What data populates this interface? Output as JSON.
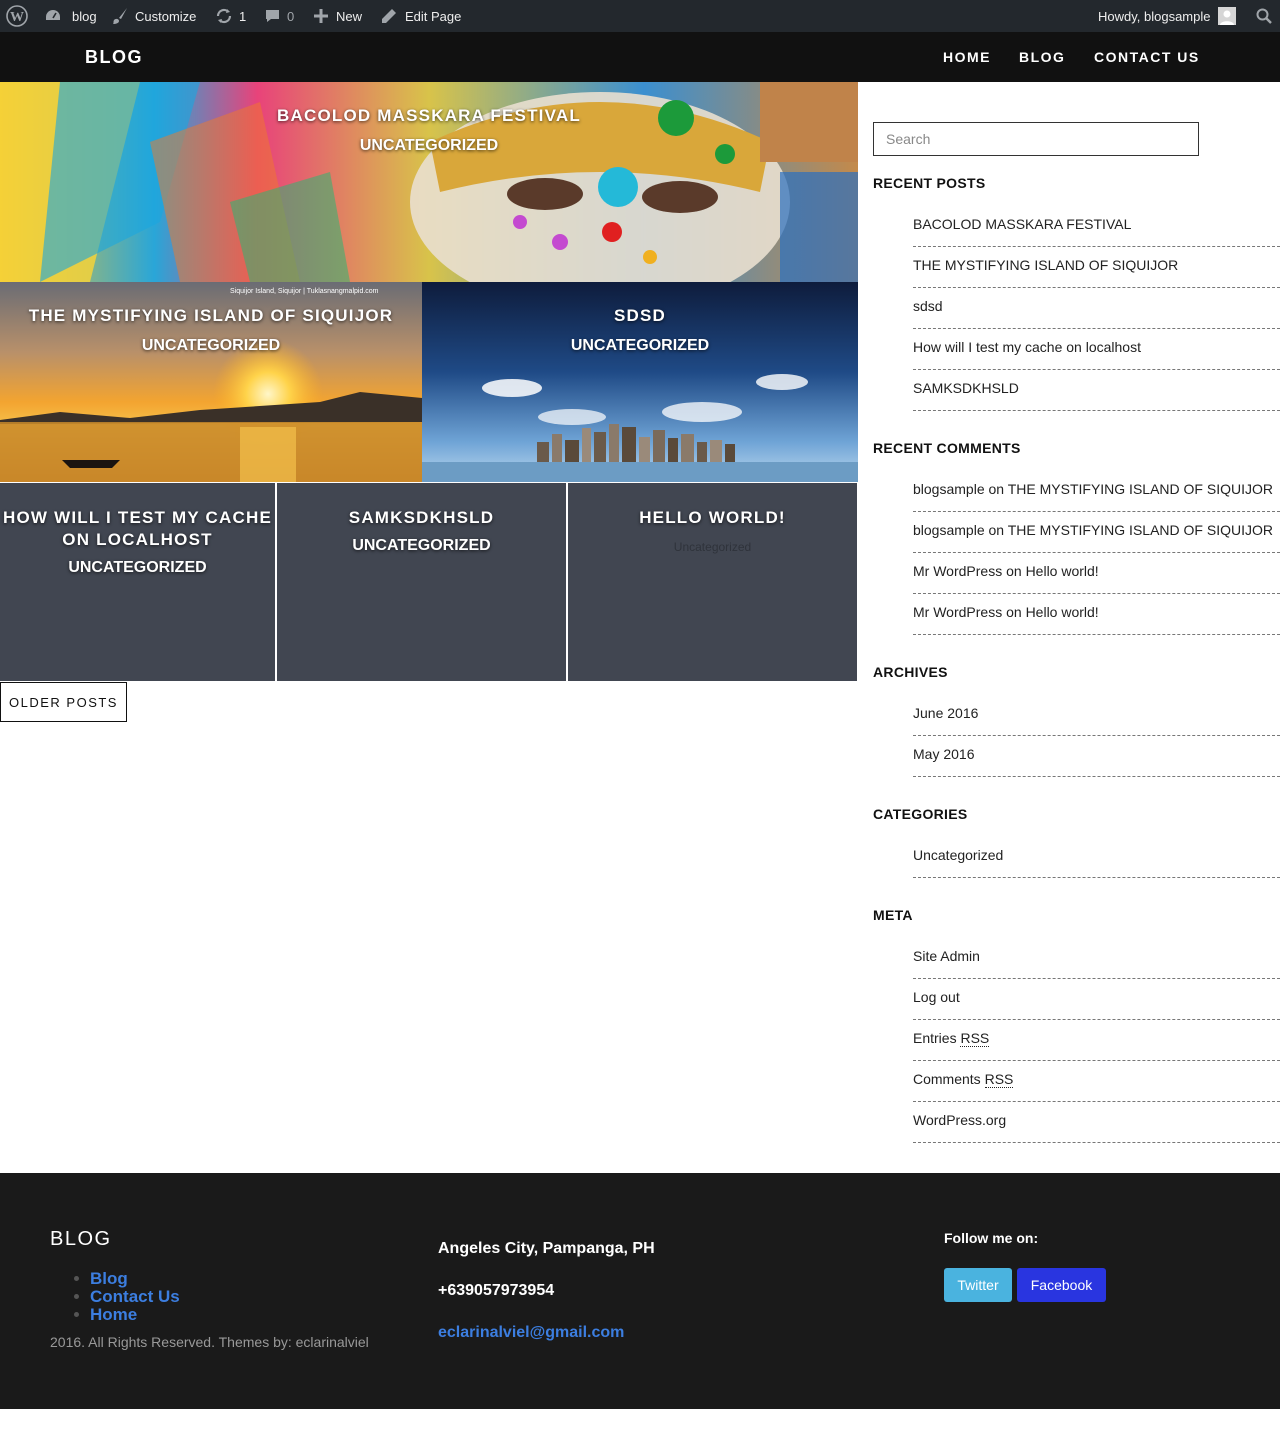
{
  "admin_bar": {
    "site_name": "blog",
    "customize": "Customize",
    "updates_count": "1",
    "comments_count": "0",
    "new": "New",
    "edit_page": "Edit Page",
    "howdy": "Howdy, blogsample"
  },
  "header": {
    "site_title": "BLOG",
    "nav": [
      "HOME",
      "BLOG",
      "CONTACT US"
    ]
  },
  "posts": [
    {
      "title": "BACOLOD MASSKARA FESTIVAL",
      "category": "UNCATEGORIZED"
    },
    {
      "title": "THE MYSTIFYING ISLAND OF SIQUIJOR",
      "category": "UNCATEGORIZED",
      "image_caption": "Siquijor Island, Siquijor | Tuklasnangmalpid.com"
    },
    {
      "title": "SDSD",
      "category": "UNCATEGORIZED"
    },
    {
      "title": "HOW WILL I TEST MY CACHE ON LOCALHOST",
      "category": "UNCATEGORIZED"
    },
    {
      "title": "SAMKSDKHSLD",
      "category": "UNCATEGORIZED"
    },
    {
      "title": "HELLO WORLD!",
      "category": "Uncategorized"
    }
  ],
  "older_posts": "OLDER POSTS",
  "sidebar": {
    "search_placeholder": "Search",
    "recent_posts_title": "RECENT POSTS",
    "recent_posts": [
      "BACOLOD MASSKARA FESTIVAL",
      "THE MYSTIFYING ISLAND OF SIQUIJOR",
      "sdsd",
      "How will I test my cache on localhost",
      "SAMKSDKHSLD"
    ],
    "recent_comments_title": "RECENT COMMENTS",
    "recent_comments": [
      {
        "author": "blogsample",
        "on": "on",
        "post": "THE MYSTIFYING ISLAND OF SIQUIJOR"
      },
      {
        "author": "blogsample",
        "on": "on",
        "post": "THE MYSTIFYING ISLAND OF SIQUIJOR"
      },
      {
        "author": "Mr WordPress",
        "on": "on",
        "post": "Hello world!"
      },
      {
        "author": "Mr WordPress",
        "on": "on",
        "post": "Hello world!"
      }
    ],
    "archives_title": "ARCHIVES",
    "archives": [
      "June 2016",
      "May 2016"
    ],
    "categories_title": "CATEGORIES",
    "categories": [
      "Uncategorized"
    ],
    "meta_title": "META",
    "meta": {
      "site_admin": "Site Admin",
      "log_out": "Log out",
      "entries": "Entries",
      "comments": "Comments",
      "rss": "RSS",
      "wordpress_org": "WordPress.org"
    }
  },
  "footer": {
    "title": "BLOG",
    "links": [
      "Blog",
      "Contact Us",
      "Home"
    ],
    "copyright": "2016. All Rights Reserved. Themes by: eclarinalviel",
    "address": "Angeles City, Pampanga, PH",
    "phone": "+639057973954",
    "email": "eclarinalviel@gmail.com",
    "follow": "Follow me on:",
    "twitter": "Twitter",
    "facebook": "Facebook"
  },
  "colors": {
    "admin_bar": "#23282d",
    "header": "#111111",
    "tile_dark": "#414651",
    "footer": "#1a1a1a",
    "link_blue": "#3c7ee0",
    "twitter": "#4ab3df",
    "facebook": "#2935e0"
  }
}
